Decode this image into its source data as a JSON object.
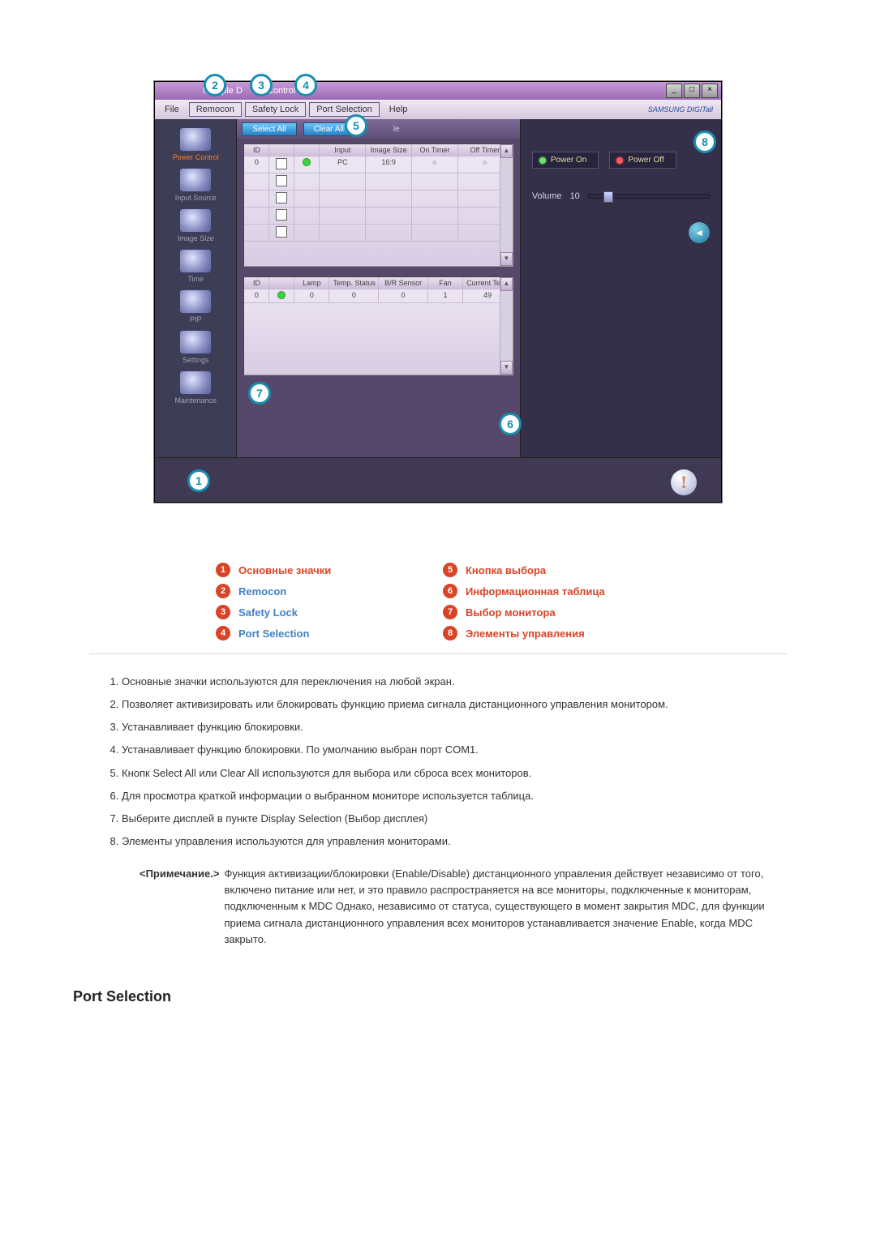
{
  "window": {
    "title_prefix": "Multiple D",
    "title_mid": "Control",
    "minimize": "_",
    "maximize": "□",
    "close": "×"
  },
  "menu": {
    "file": "File",
    "remocon": "Remocon",
    "safety_lock": "Safety Lock",
    "port_selection": "Port Selection",
    "help": "Help",
    "brand": "SAMSUNG DIGITall"
  },
  "sidebar": {
    "items": [
      {
        "label": "Power Control"
      },
      {
        "label": "Input Source"
      },
      {
        "label": "Image Size"
      },
      {
        "label": "Time"
      },
      {
        "label": "PIP"
      },
      {
        "label": "Settings"
      },
      {
        "label": "Maintenance"
      }
    ]
  },
  "select_buttons": {
    "select_all": "Select All",
    "clear_all": "Clear All",
    "le": "le"
  },
  "upper_table": {
    "headers": [
      "ID",
      "",
      "",
      "Input",
      "Image Size",
      "On Timer",
      "Off Timer"
    ],
    "row": {
      "id": "0",
      "input": "PC",
      "size": "16:9",
      "on": "○",
      "off": "○"
    }
  },
  "lower_table": {
    "headers": [
      "ID",
      "",
      "Lamp",
      "Temp. Status",
      "B/R Sensor",
      "Fan",
      "Current Temp."
    ],
    "row": {
      "id": "0",
      "lamp": "0",
      "temp_status": "0",
      "br": "0",
      "fan": "1",
      "temp": "49"
    }
  },
  "controls": {
    "power_on": "Power On",
    "power_off": "Power Off",
    "volume_label": "Volume",
    "volume_value": "10",
    "mute_icon": "◄"
  },
  "status": {
    "warn_icon": "!"
  },
  "markers": {
    "m1": "1",
    "m2": "2",
    "m3": "3",
    "m4": "4",
    "m5": "5",
    "m6": "6",
    "m7": "7",
    "m8": "8"
  },
  "legend": [
    {
      "n": "1",
      "text": "Основные значки",
      "style": "orange"
    },
    {
      "n": "5",
      "text": "Кнопка выбора",
      "style": "orange"
    },
    {
      "n": "2",
      "text": "Remocon",
      "style": "blue"
    },
    {
      "n": "6",
      "text": "Информационная таблица",
      "style": "orange"
    },
    {
      "n": "3",
      "text": "Safety Lock",
      "style": "blue"
    },
    {
      "n": "7",
      "text": "Выбор монитора",
      "style": "orange"
    },
    {
      "n": "4",
      "text": "Port Selection",
      "style": "blue"
    },
    {
      "n": "8",
      "text": "Элементы управления",
      "style": "orange"
    }
  ],
  "descriptions": [
    "Основные значки используются для переключения на любой экран.",
    "Позволяет активизировать или блокировать функцию приема сигнала дистанционного управления монитором.",
    "Устанавливает функцию блокировки.",
    "Устанавливает функцию блокировки. По умолчанию выбран порт COM1.",
    "Кнопк Select All или Clear All используются для выбора или сброса всех мониторов.",
    "Для просмотра краткой информации о выбранном мониторе используется таблица.",
    "Выберите дисплей в пункте Display Selection (Выбор дисплея)",
    "Элементы управления используются для управления мониторами."
  ],
  "note": {
    "label": "<Примечание.>",
    "body": "Функция активизации/блокировки (Enable/Disable) дистанционного управления действует независимо от того, включено питание или нет, и это правило распространяется на все мониторы, подключенные к мониторам, подключенным к MDC Однако, независимо от статуса, существующего в момент закрытия MDC, для функции приема сигнала дистанционного управления всех мониторов устанавливается значение Enable, когда MDC закрыто."
  },
  "section_title": "Port Selection"
}
